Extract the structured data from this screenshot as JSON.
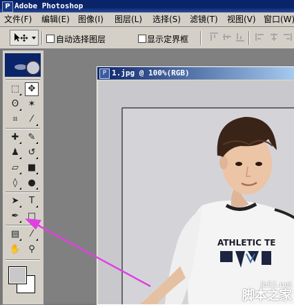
{
  "app": {
    "title": "Adobe Photoshop",
    "logo_label": "PS"
  },
  "menu": {
    "items": [
      "文件(F)",
      "编辑(E)",
      "图像(I)",
      "图层(L)",
      "选择(S)",
      "滤镜(T)",
      "视图(V)",
      "窗口(W)"
    ]
  },
  "options": {
    "auto_select_label": "自动选择图层",
    "auto_select_checked": false,
    "show_bounds_label": "显示定界框",
    "show_bounds_checked": false,
    "tool_icon": "move-icon"
  },
  "toolbox": {
    "active_tool": "move-tool",
    "highlighted_tool": "pen-tool",
    "tools": [
      {
        "name": "marquee-tool",
        "glyph": "⬚"
      },
      {
        "name": "move-tool",
        "glyph": "✥"
      },
      {
        "name": "lasso-tool",
        "glyph": "ʘ"
      },
      {
        "name": "magic-wand-tool",
        "glyph": "✶"
      },
      {
        "name": "crop-tool",
        "glyph": "⌗"
      },
      {
        "name": "slice-tool",
        "glyph": "⁄"
      },
      {
        "name": "healing-brush-tool",
        "glyph": "✚"
      },
      {
        "name": "brush-tool",
        "glyph": "✎"
      },
      {
        "name": "clone-stamp-tool",
        "glyph": "♟"
      },
      {
        "name": "history-brush-tool",
        "glyph": "↺"
      },
      {
        "name": "eraser-tool",
        "glyph": "▱"
      },
      {
        "name": "gradient-tool",
        "glyph": "■"
      },
      {
        "name": "blur-tool",
        "glyph": "◊"
      },
      {
        "name": "dodge-tool",
        "glyph": "●"
      },
      {
        "name": "path-selection-tool",
        "glyph": "➤"
      },
      {
        "name": "type-tool",
        "glyph": "T"
      },
      {
        "name": "pen-tool",
        "glyph": "✒"
      },
      {
        "name": "shape-tool",
        "glyph": "□"
      },
      {
        "name": "notes-tool",
        "glyph": "▤"
      },
      {
        "name": "eyedropper-tool",
        "glyph": "⁄"
      },
      {
        "name": "hand-tool",
        "glyph": "✋"
      },
      {
        "name": "zoom-tool",
        "glyph": "⚲"
      }
    ],
    "foreground_color": "#c8c8c8",
    "background_color": "#ffffff"
  },
  "document": {
    "title": "1.jpg @ 100%(RGB)",
    "shirt_text": "ATHLETIC TE"
  },
  "watermark": {
    "url": "jb51.net",
    "text": "脚本之家"
  },
  "annotation": {
    "arrow_color": "#e040e0"
  }
}
